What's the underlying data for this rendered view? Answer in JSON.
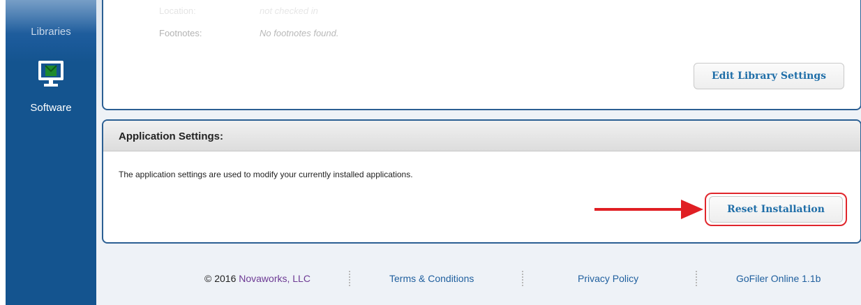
{
  "sidebar": {
    "items": [
      {
        "label": "Libraries",
        "icon": "libraries-icon"
      },
      {
        "label": "Software",
        "icon": "monitor-icon"
      }
    ]
  },
  "library_panel": {
    "faded_row_label": "Location:",
    "faded_row_value": "not checked in",
    "footnotes_label": "Footnotes:",
    "footnotes_value": "No footnotes found.",
    "edit_button_label": "Edit Library Settings"
  },
  "app_settings": {
    "title": "Application Settings:",
    "description": "The application settings are used to modify your currently installed applications.",
    "reset_button_label": "Reset Installation"
  },
  "footer": {
    "copyright_prefix": "© 2016 ",
    "company": "Novaworks, LLC",
    "terms_label": "Terms & Conditions",
    "privacy_label": "Privacy Policy",
    "version": "GoFiler Online 1.1b"
  },
  "colors": {
    "sidebar": "#14548f",
    "panel_border": "#2b5f93",
    "button_text": "#1f6ea8",
    "highlight": "#e0262c",
    "company": "#6d3a94",
    "link": "#1f5f9e"
  }
}
